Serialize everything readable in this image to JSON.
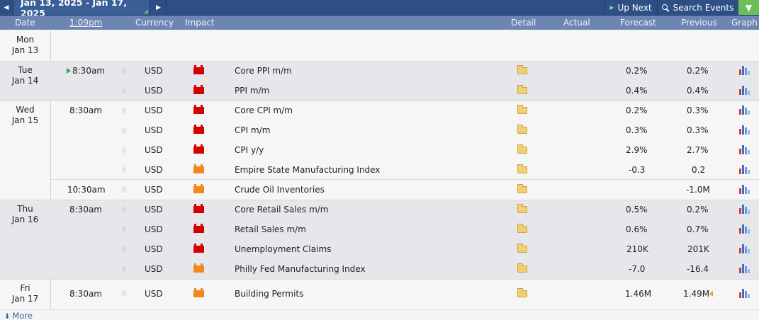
{
  "toolbar": {
    "date_range": "Jan 13, 2025 - Jan 17, 2025",
    "prev_icon": "◀",
    "next_icon": "▶",
    "up_next": "Up Next",
    "search_events": "Search Events",
    "filter_icon": "▼"
  },
  "header": {
    "date": "Date",
    "time": "1:09pm",
    "currency": "Currency",
    "impact": "Impact",
    "detail": "Detail",
    "actual": "Actual",
    "forecast": "Forecast",
    "previous": "Previous",
    "graph": "Graph"
  },
  "days": [
    {
      "dow": "Mon",
      "date": "Jan 13"
    },
    {
      "dow": "Tue",
      "date": "Jan 14"
    },
    {
      "dow": "Wed",
      "date": "Jan 15"
    },
    {
      "dow": "Thu",
      "date": "Jan 16"
    },
    {
      "dow": "Fri",
      "date": "Jan 17"
    }
  ],
  "events": [
    {
      "time": "8:30am",
      "currency": "USD",
      "impact": "high",
      "event": "Core PPI m/m",
      "actual": "",
      "forecast": "0.2%",
      "previous": "0.2%"
    },
    {
      "time": "",
      "currency": "USD",
      "impact": "high",
      "event": "PPI m/m",
      "actual": "",
      "forecast": "0.4%",
      "previous": "0.4%"
    },
    {
      "time": "8:30am",
      "currency": "USD",
      "impact": "high",
      "event": "Core CPI m/m",
      "actual": "",
      "forecast": "0.2%",
      "previous": "0.3%"
    },
    {
      "time": "",
      "currency": "USD",
      "impact": "high",
      "event": "CPI m/m",
      "actual": "",
      "forecast": "0.3%",
      "previous": "0.3%"
    },
    {
      "time": "",
      "currency": "USD",
      "impact": "high",
      "event": "CPI y/y",
      "actual": "",
      "forecast": "2.9%",
      "previous": "2.7%"
    },
    {
      "time": "",
      "currency": "USD",
      "impact": "medium",
      "event": "Empire State Manufacturing Index",
      "actual": "",
      "forecast": "-0.3",
      "previous": "0.2"
    },
    {
      "time": "10:30am",
      "currency": "USD",
      "impact": "medium",
      "event": "Crude Oil Inventories",
      "actual": "",
      "forecast": "",
      "previous": "-1.0M"
    },
    {
      "time": "8:30am",
      "currency": "USD",
      "impact": "high",
      "event": "Core Retail Sales m/m",
      "actual": "",
      "forecast": "0.5%",
      "previous": "0.2%"
    },
    {
      "time": "",
      "currency": "USD",
      "impact": "high",
      "event": "Retail Sales m/m",
      "actual": "",
      "forecast": "0.6%",
      "previous": "0.7%"
    },
    {
      "time": "",
      "currency": "USD",
      "impact": "high",
      "event": "Unemployment Claims",
      "actual": "",
      "forecast": "210K",
      "previous": "201K"
    },
    {
      "time": "",
      "currency": "USD",
      "impact": "medium",
      "event": "Philly Fed Manufacturing Index",
      "actual": "",
      "forecast": "-7.0",
      "previous": "-16.4"
    },
    {
      "time": "8:30am",
      "currency": "USD",
      "impact": "medium",
      "event": "Building Permits",
      "actual": "",
      "forecast": "1.46M",
      "previous": "1.49M"
    }
  ],
  "footer": {
    "more": "More",
    "more_icon": "⬇"
  },
  "colors": {
    "toolbar": "#2d4f85",
    "header": "#6d85b3",
    "impact_high": "#d60000",
    "impact_medium": "#f0881e",
    "accent_green": "#6abf5b"
  }
}
